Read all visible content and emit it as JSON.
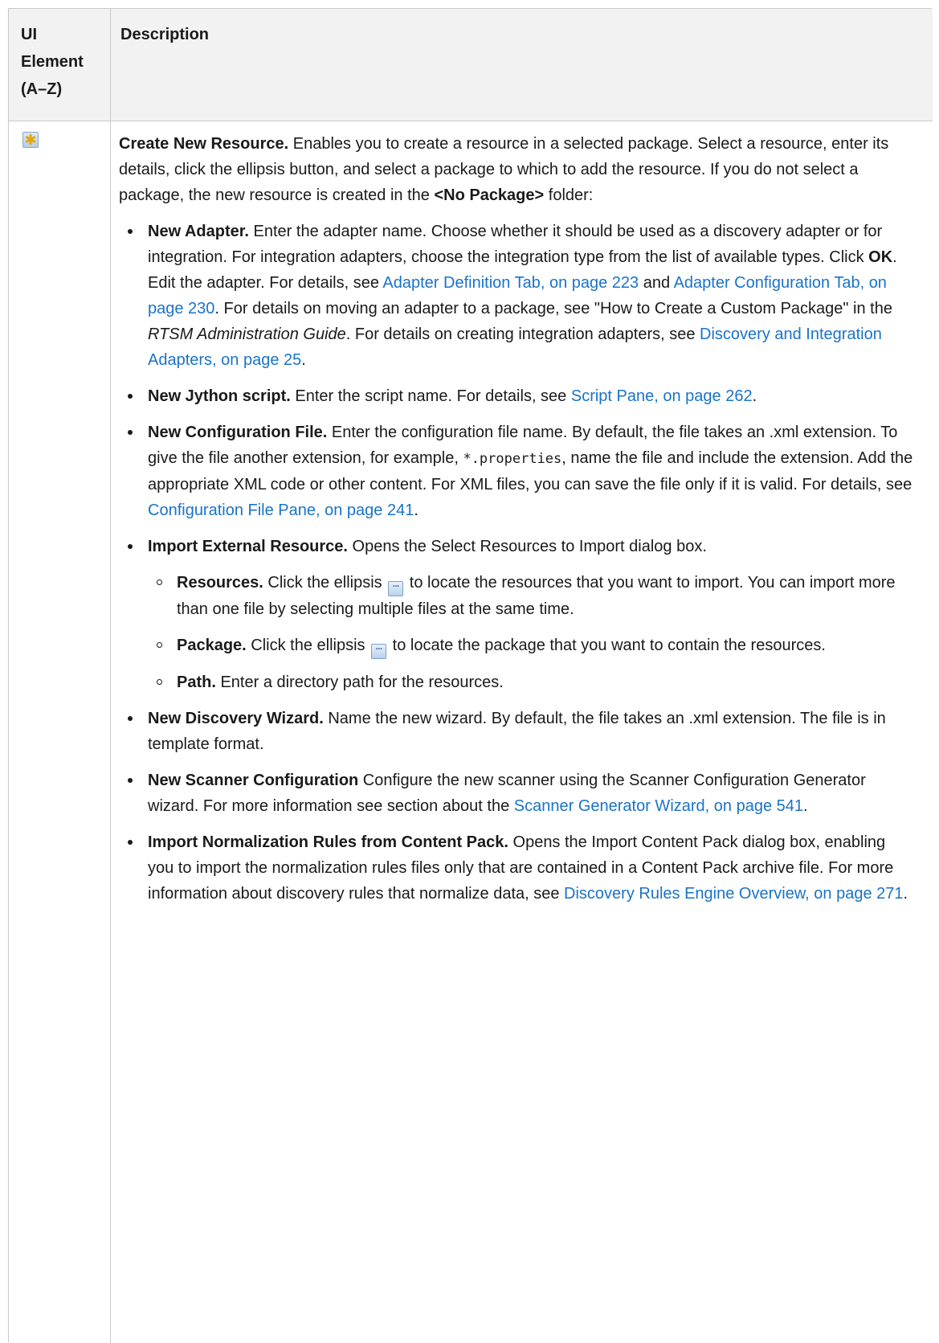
{
  "table": {
    "header": {
      "col1": [
        "UI",
        "Element",
        "(A–Z)"
      ],
      "col2": "Description"
    },
    "row": {
      "icon": "create-new-resource-icon",
      "intro": {
        "title": "Create New Resource.",
        "text1": " Enables you to create a resource in a selected package. Select a resource, enter its details, click the ellipsis  button, and select a package to which to add the resource. If you do not select a package, the new resource is created in the ",
        "bold2": "<No Package>",
        "text2": " folder:"
      },
      "items": {
        "adapter": {
          "title": "New Adapter.",
          "t1": " Enter the adapter name. Choose whether it should be used as a discovery adapter or for integration. For integration adapters, choose the integration type from the list of available types. Click ",
          "ok": "OK",
          "t2": ". Edit the adapter. For details, see ",
          "link1": "Adapter Definition Tab, on page 223",
          "t3": " and ",
          "link2": "Adapter Configuration Tab, on page 230",
          "t4": ". For details on moving an adapter to a package, see \"How to Create a Custom Package\" in the ",
          "guide": "RTSM Administration Guide",
          "t5": ". For details on creating integration adapters, see ",
          "link3": "Discovery and Integration Adapters, on page 25",
          "t6": "."
        },
        "jython": {
          "title": "New Jython script.",
          "t1": " Enter the script name. For details, see ",
          "link": "Script Pane, on page 262",
          "t2": "."
        },
        "config": {
          "title": "New Configuration File.",
          "t1": " Enter the configuration file name. By default, the file takes an .xml extension. To give the file another extension, for example, ",
          "code": "*.properties",
          "t2": ", name the file and include the extension. Add the appropriate XML code or other content. For XML files, you can save the file only if it is valid. For details, see ",
          "link": "Configuration File Pane, on page 241",
          "t3": "."
        },
        "import_ext": {
          "title": "Import External Resource.",
          "t1": " Opens the Select Resources to Import dialog box.",
          "sub": {
            "resources": {
              "title": "Resources.",
              "t1": " Click the ellipsis ",
              "t2": " to locate the resources that you want to import. You can import more than one file by selecting multiple files at the same time."
            },
            "package": {
              "title": "Package.",
              "t1": " Click the ellipsis ",
              "t2": " to locate the package that you want to contain the resources."
            },
            "path": {
              "title": "Path.",
              "t1": " Enter a directory path for the resources."
            }
          }
        },
        "wizard": {
          "title": "New Discovery Wizard.",
          "t1": " Name the new wizard. By default, the file takes an .xml extension. The file is in template format."
        },
        "scanner": {
          "title": "New Scanner Configuration",
          "t1": " Configure the new scanner using the Scanner Configuration Generator wizard. For more information see section about the ",
          "link": "Scanner Generator Wizard, on page 541",
          "t2": "."
        },
        "norm": {
          "title": "Import Normalization Rules from Content Pack.",
          "t1": " Opens the Import Content Pack dialog box, enabling you to import the normalization rules files only that are contained in a Content Pack archive file. For more information about discovery rules that normalize data, see ",
          "link": "Discovery Rules Engine Overview, on page 271",
          "t2": "."
        }
      }
    }
  },
  "colors": {
    "link": "#1a73c8",
    "header_bg": "#f2f2f2",
    "border": "#c9c9c9",
    "text": "#1a1a1a"
  }
}
